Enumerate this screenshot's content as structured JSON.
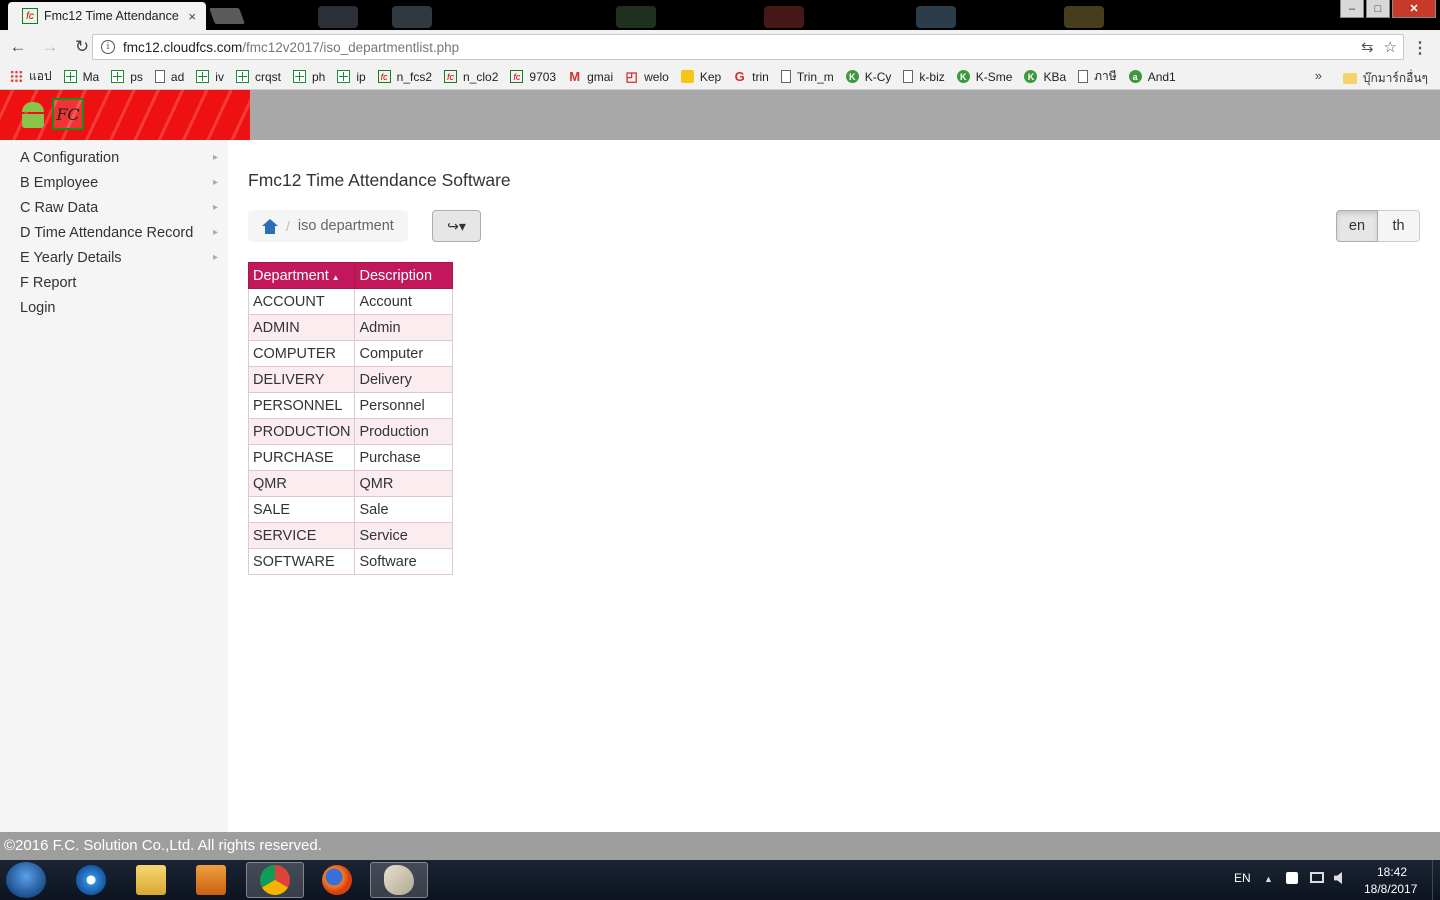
{
  "browser": {
    "tab_title": "Fmc12 Time Attendance",
    "tab_close": "×",
    "url_host": "fmc12.cloudfcs.com",
    "url_path": "/fmc12v2017/iso_departmentlist.php",
    "nav_back": "←",
    "nav_forward": "→",
    "nav_reload": "↻",
    "translate_icon": "⇆",
    "star_icon": "☆",
    "menu_icon": "⋮",
    "window_minimize": "–",
    "window_maximize": "□",
    "window_close": "✕",
    "bookmarks": [
      {
        "label": "แอป",
        "icon": "apps-icon"
      },
      {
        "label": "Ma",
        "icon": "sheet-icon"
      },
      {
        "label": "ps",
        "icon": "sheet-icon"
      },
      {
        "label": "ad",
        "icon": "page-icon"
      },
      {
        "label": "iv",
        "icon": "sheet-icon"
      },
      {
        "label": "crqst",
        "icon": "sheet-icon"
      },
      {
        "label": "ph",
        "icon": "sheet-icon"
      },
      {
        "label": "ip",
        "icon": "sheet-icon"
      },
      {
        "label": "n_fcs2",
        "icon": "fc-icon"
      },
      {
        "label": "n_clo2",
        "icon": "fc-icon"
      },
      {
        "label": "9703",
        "icon": "fc-icon"
      },
      {
        "label": "gmai",
        "icon": "gmail-icon"
      },
      {
        "label": "welo",
        "icon": "bag-icon"
      },
      {
        "label": "Kep",
        "icon": "keep-icon"
      },
      {
        "label": "trin",
        "icon": "google-icon"
      },
      {
        "label": "Trin_m",
        "icon": "page-icon"
      },
      {
        "label": "K-Cy",
        "icon": "kbank-icon"
      },
      {
        "label": "k-biz",
        "icon": "page-icon"
      },
      {
        "label": "K-Sme",
        "icon": "kbank-icon"
      },
      {
        "label": "KBa",
        "icon": "kbank-icon"
      },
      {
        "label": "ภาษี",
        "icon": "tax-icon"
      },
      {
        "label": "And1",
        "icon": "android-icon"
      }
    ],
    "bookmarks_more": "»",
    "bookmark_folder": "บุ๊กมาร์กอื่นๆ"
  },
  "app": {
    "logo_text": "FC",
    "sidebar": {
      "items": [
        {
          "label": "A Configuration",
          "has_submenu": true
        },
        {
          "label": "B Employee",
          "has_submenu": true
        },
        {
          "label": "C Raw Data",
          "has_submenu": true
        },
        {
          "label": "D Time Attendance Record",
          "has_submenu": true
        },
        {
          "label": "E Yearly Details",
          "has_submenu": true
        },
        {
          "label": "F Report",
          "has_submenu": false
        },
        {
          "label": "Login",
          "has_submenu": false
        }
      ],
      "caret": "▸"
    },
    "page_title": "Fmc12 Time Attendance Software",
    "breadcrumb": {
      "separator": "/",
      "current": "iso department"
    },
    "export_button": "↪▾",
    "languages": [
      "en",
      "th"
    ],
    "active_language": "en",
    "table": {
      "columns": [
        "Department",
        "Description"
      ],
      "sort_indicator": "▲",
      "rows": [
        [
          "ACCOUNT",
          "Account"
        ],
        [
          "ADMIN",
          "Admin"
        ],
        [
          "COMPUTER",
          "Computer"
        ],
        [
          "DELIVERY",
          "Delivery"
        ],
        [
          "PERSONNEL",
          "Personnel"
        ],
        [
          "PRODUCTION",
          "Production"
        ],
        [
          "PURCHASE",
          "Purchase"
        ],
        [
          "QMR",
          "QMR"
        ],
        [
          "SALE",
          "Sale"
        ],
        [
          "SERVICE",
          "Service"
        ],
        [
          "SOFTWARE",
          "Software"
        ]
      ]
    },
    "footer": "©2016 F.C. Solution Co.,Ltd. All rights reserved."
  },
  "taskbar": {
    "language": "EN",
    "time": "18:42",
    "date": "18/8/2017",
    "tray_up": "▲"
  },
  "colors": {
    "table_header": "#c2185b",
    "row_alt": "#fbecef",
    "logo_red": "#ee1111",
    "header_gray": "#a8a8a8"
  }
}
